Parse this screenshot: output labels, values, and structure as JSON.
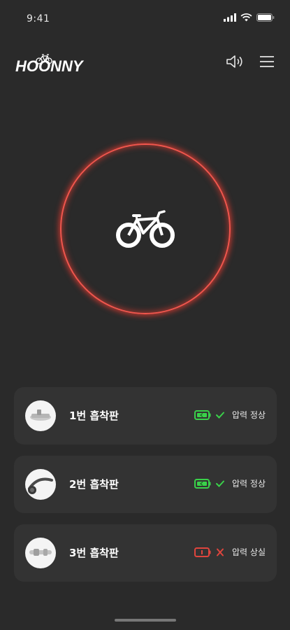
{
  "status_bar": {
    "time": "9:41"
  },
  "header": {
    "logo_text": "HOONNY"
  },
  "cups": [
    {
      "name": "1번 흡착판",
      "status": "압력 정상",
      "state": "normal"
    },
    {
      "name": "2번 흡착판",
      "status": "압력 정상",
      "state": "normal"
    },
    {
      "name": "3번 흡착판",
      "status": "압력 상실",
      "state": "lost"
    }
  ],
  "colors": {
    "accent_ring": "#f1564d",
    "ok": "#3ad14a",
    "error": "#e0453d",
    "background": "#2a2a2a",
    "card": "#333333"
  }
}
